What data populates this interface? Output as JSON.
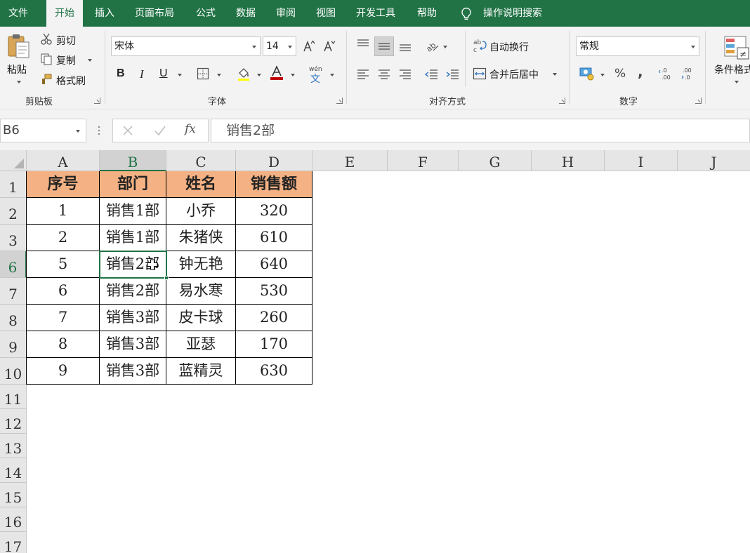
{
  "ribbon_tabs": [
    {
      "label": "文件"
    },
    {
      "label": "开始"
    },
    {
      "label": "插入"
    },
    {
      "label": "页面布局"
    },
    {
      "label": "公式"
    },
    {
      "label": "数据"
    },
    {
      "label": "审阅"
    },
    {
      "label": "视图"
    },
    {
      "label": "开发工具"
    },
    {
      "label": "帮助"
    }
  ],
  "tell_me": "操作说明搜索",
  "clipboard": {
    "paste": "粘贴",
    "cut": "剪切",
    "copy": "复制",
    "format_painter": "格式刷",
    "group": "剪贴板"
  },
  "font": {
    "name": "宋体",
    "size": "14",
    "bold": "B",
    "italic": "I",
    "underline": "U",
    "phonetic": "wén",
    "group": "字体"
  },
  "alignment": {
    "wrap_text": "自动换行",
    "merge_center": "合并后居中",
    "group": "对齐方式"
  },
  "number": {
    "format": "常规",
    "percent": "%",
    "comma": ",",
    "group": "数字"
  },
  "styles": {
    "conditional_format": "条件格式"
  },
  "formula_bar": {
    "name_box": "B6",
    "fx": "fx",
    "content": "销售2部"
  },
  "columns": [
    "A",
    "B",
    "C",
    "D",
    "E",
    "F",
    "G",
    "H",
    "I",
    "J"
  ],
  "selected_column": "B",
  "selected_row": "6",
  "table": {
    "headers": [
      "序号",
      "部门",
      "姓名",
      "销售额"
    ],
    "rows": [
      {
        "row": "2",
        "cells": [
          "1",
          "销售1部",
          "小乔",
          "320"
        ]
      },
      {
        "row": "3",
        "cells": [
          "2",
          "销售1部",
          "朱猪侠",
          "610"
        ]
      },
      {
        "row": "6",
        "cells": [
          "5",
          "销售2部",
          "钟无艳",
          "640"
        ]
      },
      {
        "row": "7",
        "cells": [
          "6",
          "销售2部",
          "易水寒",
          "530"
        ]
      },
      {
        "row": "8",
        "cells": [
          "7",
          "销售3部",
          "皮卡球",
          "260"
        ]
      },
      {
        "row": "9",
        "cells": [
          "8",
          "销售3部",
          "亚瑟",
          "170"
        ]
      },
      {
        "row": "10",
        "cells": [
          "9",
          "销售3部",
          "蓝精灵",
          "630"
        ]
      }
    ]
  },
  "header_row": "1",
  "empty_rows": [
    "11",
    "12",
    "13",
    "14",
    "15",
    "16",
    "17"
  ],
  "colors": {
    "accent": "#217346",
    "header_fill": "#f4b183",
    "font_color_bar": "#c00000"
  }
}
